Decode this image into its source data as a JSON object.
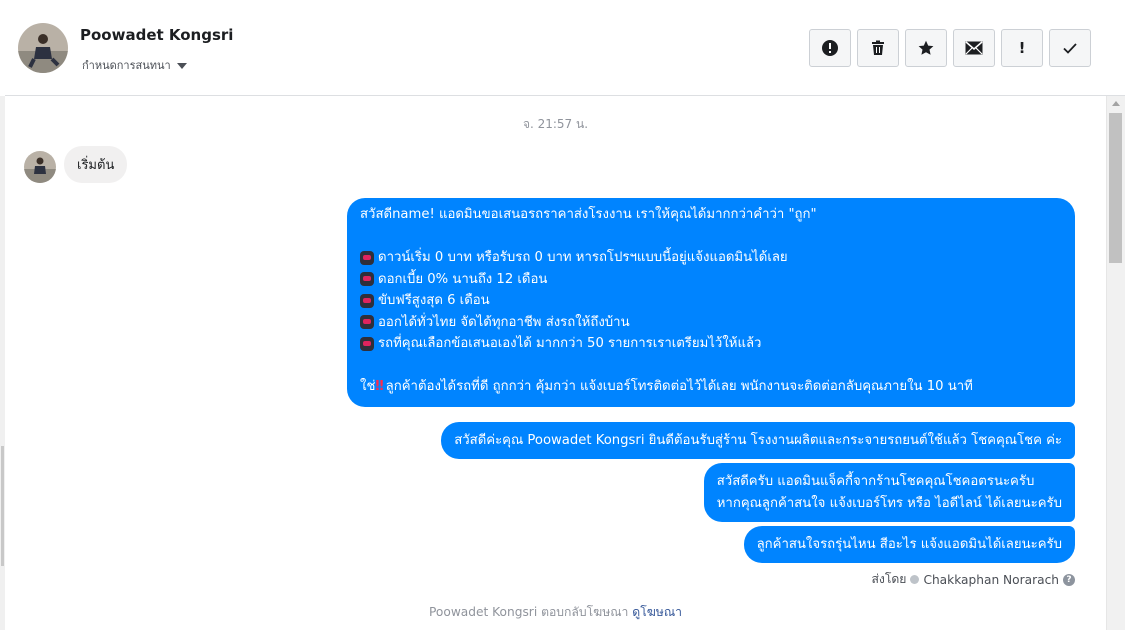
{
  "header": {
    "contact_name": "Poowadet Kongsri",
    "assign_label": "กำหนดการสนทนา",
    "actions": [
      {
        "name": "spam",
        "glyph": "!"
      },
      {
        "name": "delete",
        "glyph": "🗑"
      },
      {
        "name": "star",
        "glyph": "★"
      },
      {
        "name": "mark-unread",
        "glyph": "✉"
      },
      {
        "name": "follow-up",
        "glyph": "!"
      },
      {
        "name": "done",
        "glyph": "✓"
      }
    ]
  },
  "thread": {
    "timestamp": "จ. 21:57 น.",
    "incoming": {
      "text": "เริ่มต้น"
    },
    "msg1": {
      "line1": "สวัสดีname! แอดมินขอเสนอรถราคาส่งโรงงาน เราให้คุณได้มากกว่าคำว่า \"ถูก\"",
      "bullets": [
        "ดาวน์เริ่ม 0 บาท หรือรับรถ 0 บาท หารถโปรฯแบบนี้อยู่แจ้งแอดมินได้เลย",
        "ดอกเบี้ย 0% นานถึง 12 เดือน",
        "ขับฟรีสูงสุด 6 เดือน",
        "ออกได้ทั่วไทย จัดได้ทุกอาชีพ ส่งรถให้ถึงบ้าน",
        "รถที่คุณเลือกข้อเสนอเองได้ มากกว่า 50 รายการเราเตรียมไว้ให้แล้ว"
      ],
      "last_prefix": "ใช่",
      "last_mark": "‼",
      "last_text": "ลูกค้าต้องได้รถที่ดี ถูกกว่า คุ้มกว่า แจ้งเบอร์โทรติดต่อไว้ได้เลย พนักงานจะติดต่อกลับคุณภายใน 10 นาที"
    },
    "msg2": "สวัสดีค่ะคุณ Poowadet Kongsri ยินดีต้อนรับสู่ร้าน โรงงานผลิตและกระจายรถยนต์ใช้แล้ว โชคคุณโชค ค่ะ",
    "msg3": {
      "line1": "สวัสดีครับ แอดมินแจ็คกี้จากร้านโชคคุณโชคอตรนะครับ",
      "line2": "หากคุณลูกค้าสนใจ แจ้งเบอร์โทร หรือ ไอดีไลน์ ได้เลยนะครับ"
    },
    "msg4": "ลูกค้าสนใจรถรุ่นไหน สีอะไร แจ้งแอดมินได้เลยนะครับ",
    "sent_by_label": "ส่งโดย",
    "sender_name": "Chakkaphan Norarach",
    "help_glyph": "?",
    "footer_text": "Poowadet Kongsri ตอบกลับโฆษณา",
    "footer_link": "ดูโฆษณา"
  },
  "colors": {
    "bubble_outgoing": "#0084ff",
    "bubble_incoming": "#f1f0f0",
    "link": "#365899"
  }
}
